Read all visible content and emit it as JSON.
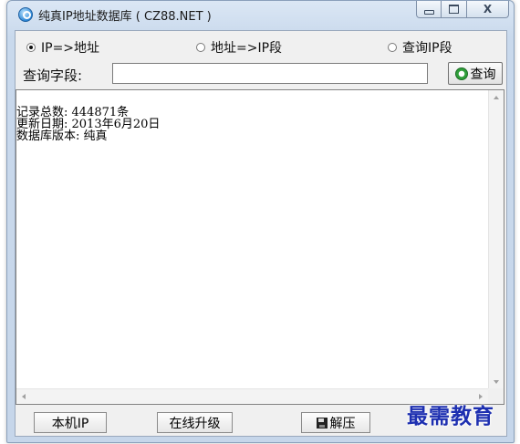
{
  "window": {
    "title": "纯真IP地址数据库 ( CZ88.NET )"
  },
  "search_mode": {
    "options": [
      {
        "label": "IP=>地址",
        "checked": true
      },
      {
        "label": "地址=>IP段",
        "checked": false
      },
      {
        "label": "查询IP段",
        "checked": false
      }
    ]
  },
  "query": {
    "label": "查询字段:",
    "value": "",
    "button_label": "查询"
  },
  "output": {
    "lines": "记录总数: 444871条\n更新日期: 2013年6月20日\n数据库版本: 纯真"
  },
  "bottom_buttons": {
    "local_ip": "本机IP",
    "online_upgrade": "在线升级",
    "decompress": "解压"
  },
  "watermark": {
    "text": "最需教育"
  },
  "icons": {
    "app": "app-icon",
    "query": "refresh-icon",
    "decompress": "floppy-icon"
  }
}
